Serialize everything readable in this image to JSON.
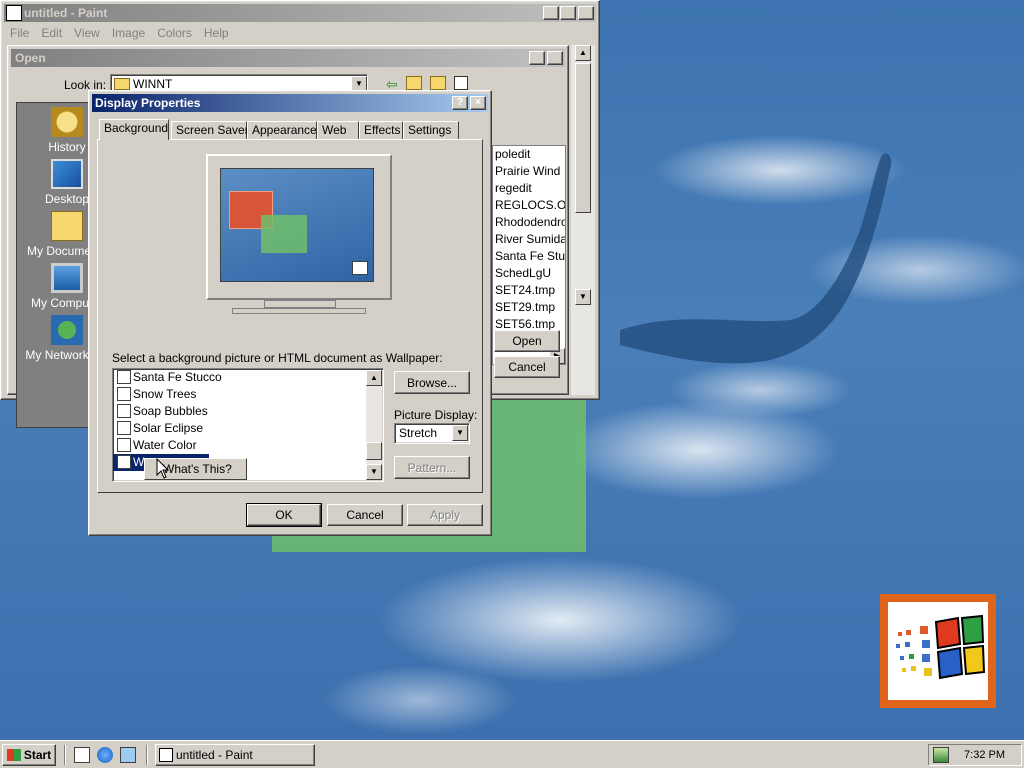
{
  "paint": {
    "title": "untitled - Paint",
    "menu": [
      "File",
      "Edit",
      "View",
      "Image",
      "Colors",
      "Help"
    ]
  },
  "open_dialog": {
    "title": "Open",
    "look_in_label": "Look in:",
    "look_in_value": "WINNT",
    "places": [
      "History",
      "Desktop",
      "My Documents",
      "My Computer",
      "My Network P..."
    ],
    "files": [
      "poledit",
      "Prairie Wind",
      "regedit",
      "REGLOCS.OL",
      "Rhododendro",
      "River Sumida",
      "Santa Fe Stu",
      "SchedLgU",
      "SET24.tmp",
      "SET29.tmp",
      "SET56.tmp"
    ],
    "open_label": "Open",
    "cancel_label": "Cancel"
  },
  "display_properties": {
    "title": "Display Properties",
    "tabs": [
      "Background",
      "Screen Saver",
      "Appearance",
      "Web",
      "Effects",
      "Settings"
    ],
    "selected_tab": "Background",
    "wallpaper_prompt": "Select a background picture or HTML document as Wallpaper:",
    "wallpapers": [
      "Santa Fe Stucco",
      "Snow Trees",
      "Soap Bubbles",
      "Solar Eclipse",
      "Water Color",
      "W"
    ],
    "browse_label": "Browse...",
    "picture_display_label": "Picture Display:",
    "picture_display_value": "Stretch",
    "pattern_label": "Pattern...",
    "ok_label": "OK",
    "cancel_label": "Cancel",
    "apply_label": "Apply"
  },
  "context_menu": {
    "item": "What's This?"
  },
  "taskbar": {
    "start_label": "Start",
    "task_label": "untitled - Paint",
    "clock": "7:32 PM"
  },
  "colors": {
    "desktop": "#3a6ea5",
    "active_title": "#0a246a",
    "inactive_title": "#808080",
    "face": "#d4d0c8"
  }
}
